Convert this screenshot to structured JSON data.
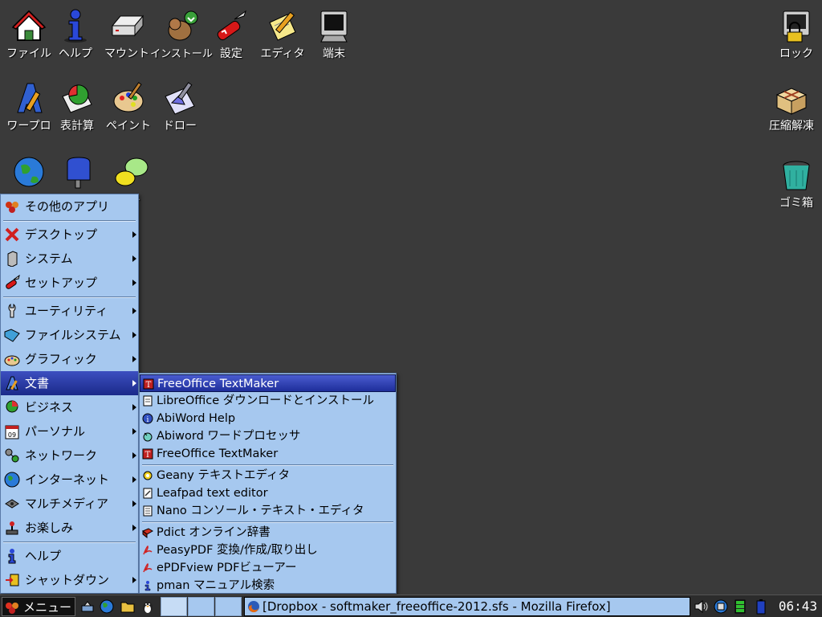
{
  "desktop_icons": {
    "file": "ファイル",
    "help": "ヘルプ",
    "mount": "マウント",
    "install": "インストール",
    "settings": "設定",
    "editor": "エディタ",
    "terminal": "端末",
    "lock": "ロック",
    "wordpro": "ワープロ",
    "spreadsheet": "表計算",
    "paint": "ペイント",
    "draw": "ドロー",
    "archive": "圧縮解凍",
    "trash": "ゴミ箱",
    "chat_partial": "ト"
  },
  "main_menu": {
    "other_apps": "その他のアプリ",
    "desktop": "デスクトップ",
    "system": "システム",
    "setup": "セットアップ",
    "utility": "ユーティリティ",
    "filesystem": "ファイルシステム",
    "graphic": "グラフィック",
    "document": "文書",
    "business": "ビジネス",
    "personal": "パーソナル",
    "network": "ネットワーク",
    "internet": "インターネット",
    "multimedia": "マルチメディア",
    "fun": "お楽しみ",
    "help": "ヘルプ",
    "shutdown": "シャットダウン"
  },
  "submenu": {
    "freeoffice1": "FreeOffice TextMaker",
    "libreoffice": "LibreOffice ダウンロードとインストール",
    "abiword_help": "AbiWord Help",
    "abiword": "Abiword ワードプロセッサ",
    "freeoffice2": "FreeOffice TextMaker",
    "geany": "Geany テキストエディタ",
    "leafpad": "Leafpad text editor",
    "nano": "Nano コンソール・テキスト・エディタ",
    "pdict": "Pdict オンライン辞書",
    "peasypdf": "PeasyPDF 変換/作成/取り出し",
    "epdfview": "ePDFview PDFビューアー",
    "pman": "pman マニュアル検索"
  },
  "taskbar": {
    "menu_label": "メニュー",
    "task_title": "[Dropbox - softmaker_freeoffice-2012.sfs - Mozilla Firefox]",
    "clock": "06:43"
  }
}
